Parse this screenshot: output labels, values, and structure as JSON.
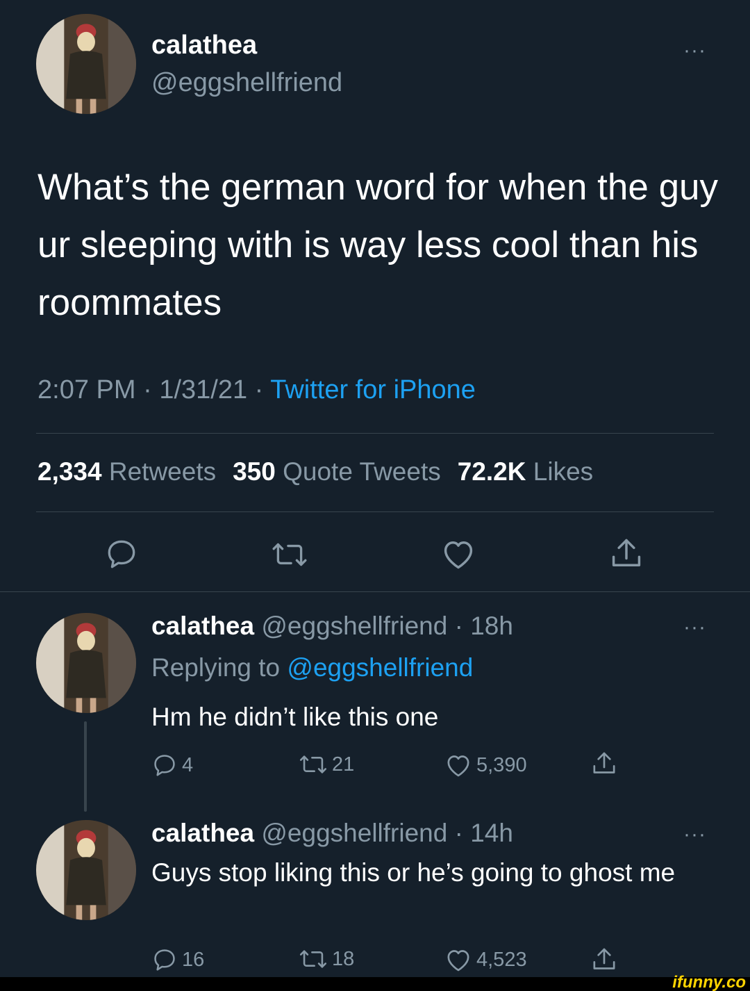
{
  "main_tweet": {
    "name": "calathea",
    "handle": "@eggshellfriend",
    "text": "What’s the german word for when the guy ur sleeping with is way less cool than his roommates",
    "time": "2:07 PM",
    "date": "1/31/21",
    "source": "Twitter for iPhone",
    "separator": " · ",
    "stats": {
      "retweets_count": "2,334",
      "retweets_label": "Retweets",
      "quotes_count": "350",
      "quotes_label": "Quote Tweets",
      "likes_count": "72.2K",
      "likes_label": "Likes"
    }
  },
  "replies": [
    {
      "name": "calathea",
      "handle": "@eggshellfriend",
      "time_sep": " · ",
      "time": "18h",
      "replying_label": "Replying to ",
      "replying_to": "@eggshellfriend",
      "text": "Hm he didn’t like this one",
      "reply_count": "4",
      "retweet_count": "21",
      "like_count": "5,390"
    },
    {
      "name": "calathea",
      "handle": "@eggshellfriend",
      "time_sep": " · ",
      "time": "14h",
      "text": "Guys stop liking this or he’s going to ghost me",
      "reply_count": "16",
      "retweet_count": "18",
      "like_count": "4,523"
    }
  ],
  "more_label": "···",
  "watermark": "ifunny.co",
  "icons": [
    "reply-icon",
    "retweet-icon",
    "like-icon",
    "share-icon",
    "more-icon"
  ],
  "colors": {
    "background": "#15202b",
    "muted": "#8899a6",
    "link": "#1da1f2",
    "divider": "#38444d"
  }
}
